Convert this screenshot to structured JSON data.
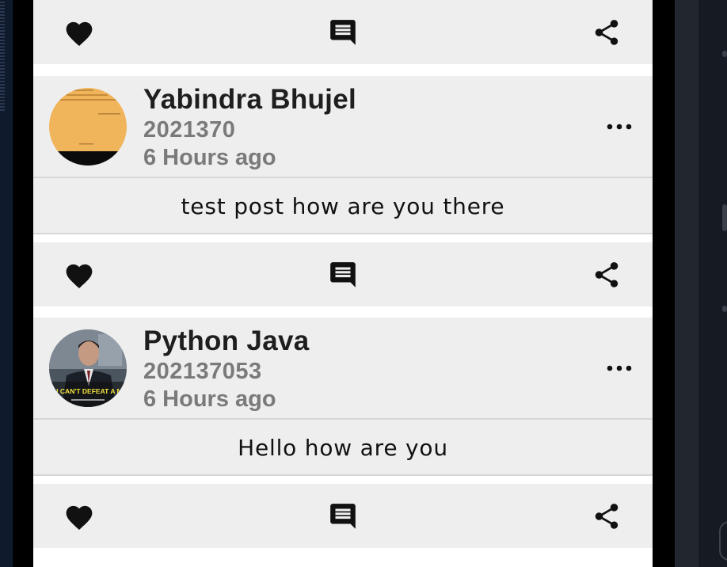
{
  "feed": {
    "actions": {
      "like_icon": "heart-icon",
      "comment_icon": "comment-icon",
      "share_icon": "share-icon"
    },
    "posts": [
      {
        "author_name": "Yabindra Bhujel",
        "author_id": "2021370",
        "time_ago": "6 Hours ago",
        "content": "test post how are you there",
        "avatar_color": "#f0b45a"
      },
      {
        "author_name": "Python Java",
        "author_id": "202137053",
        "time_ago": "6 Hours ago",
        "content": "Hello how are you",
        "avatar_caption": "YOU CAN'T DEFEAT A MAN"
      }
    ]
  },
  "colors": {
    "card_background": "#eeeeee",
    "divider": "#d6d6d6",
    "name_text": "#1e1e1e",
    "meta_text": "#7a7a7a",
    "icon": "#111111"
  }
}
